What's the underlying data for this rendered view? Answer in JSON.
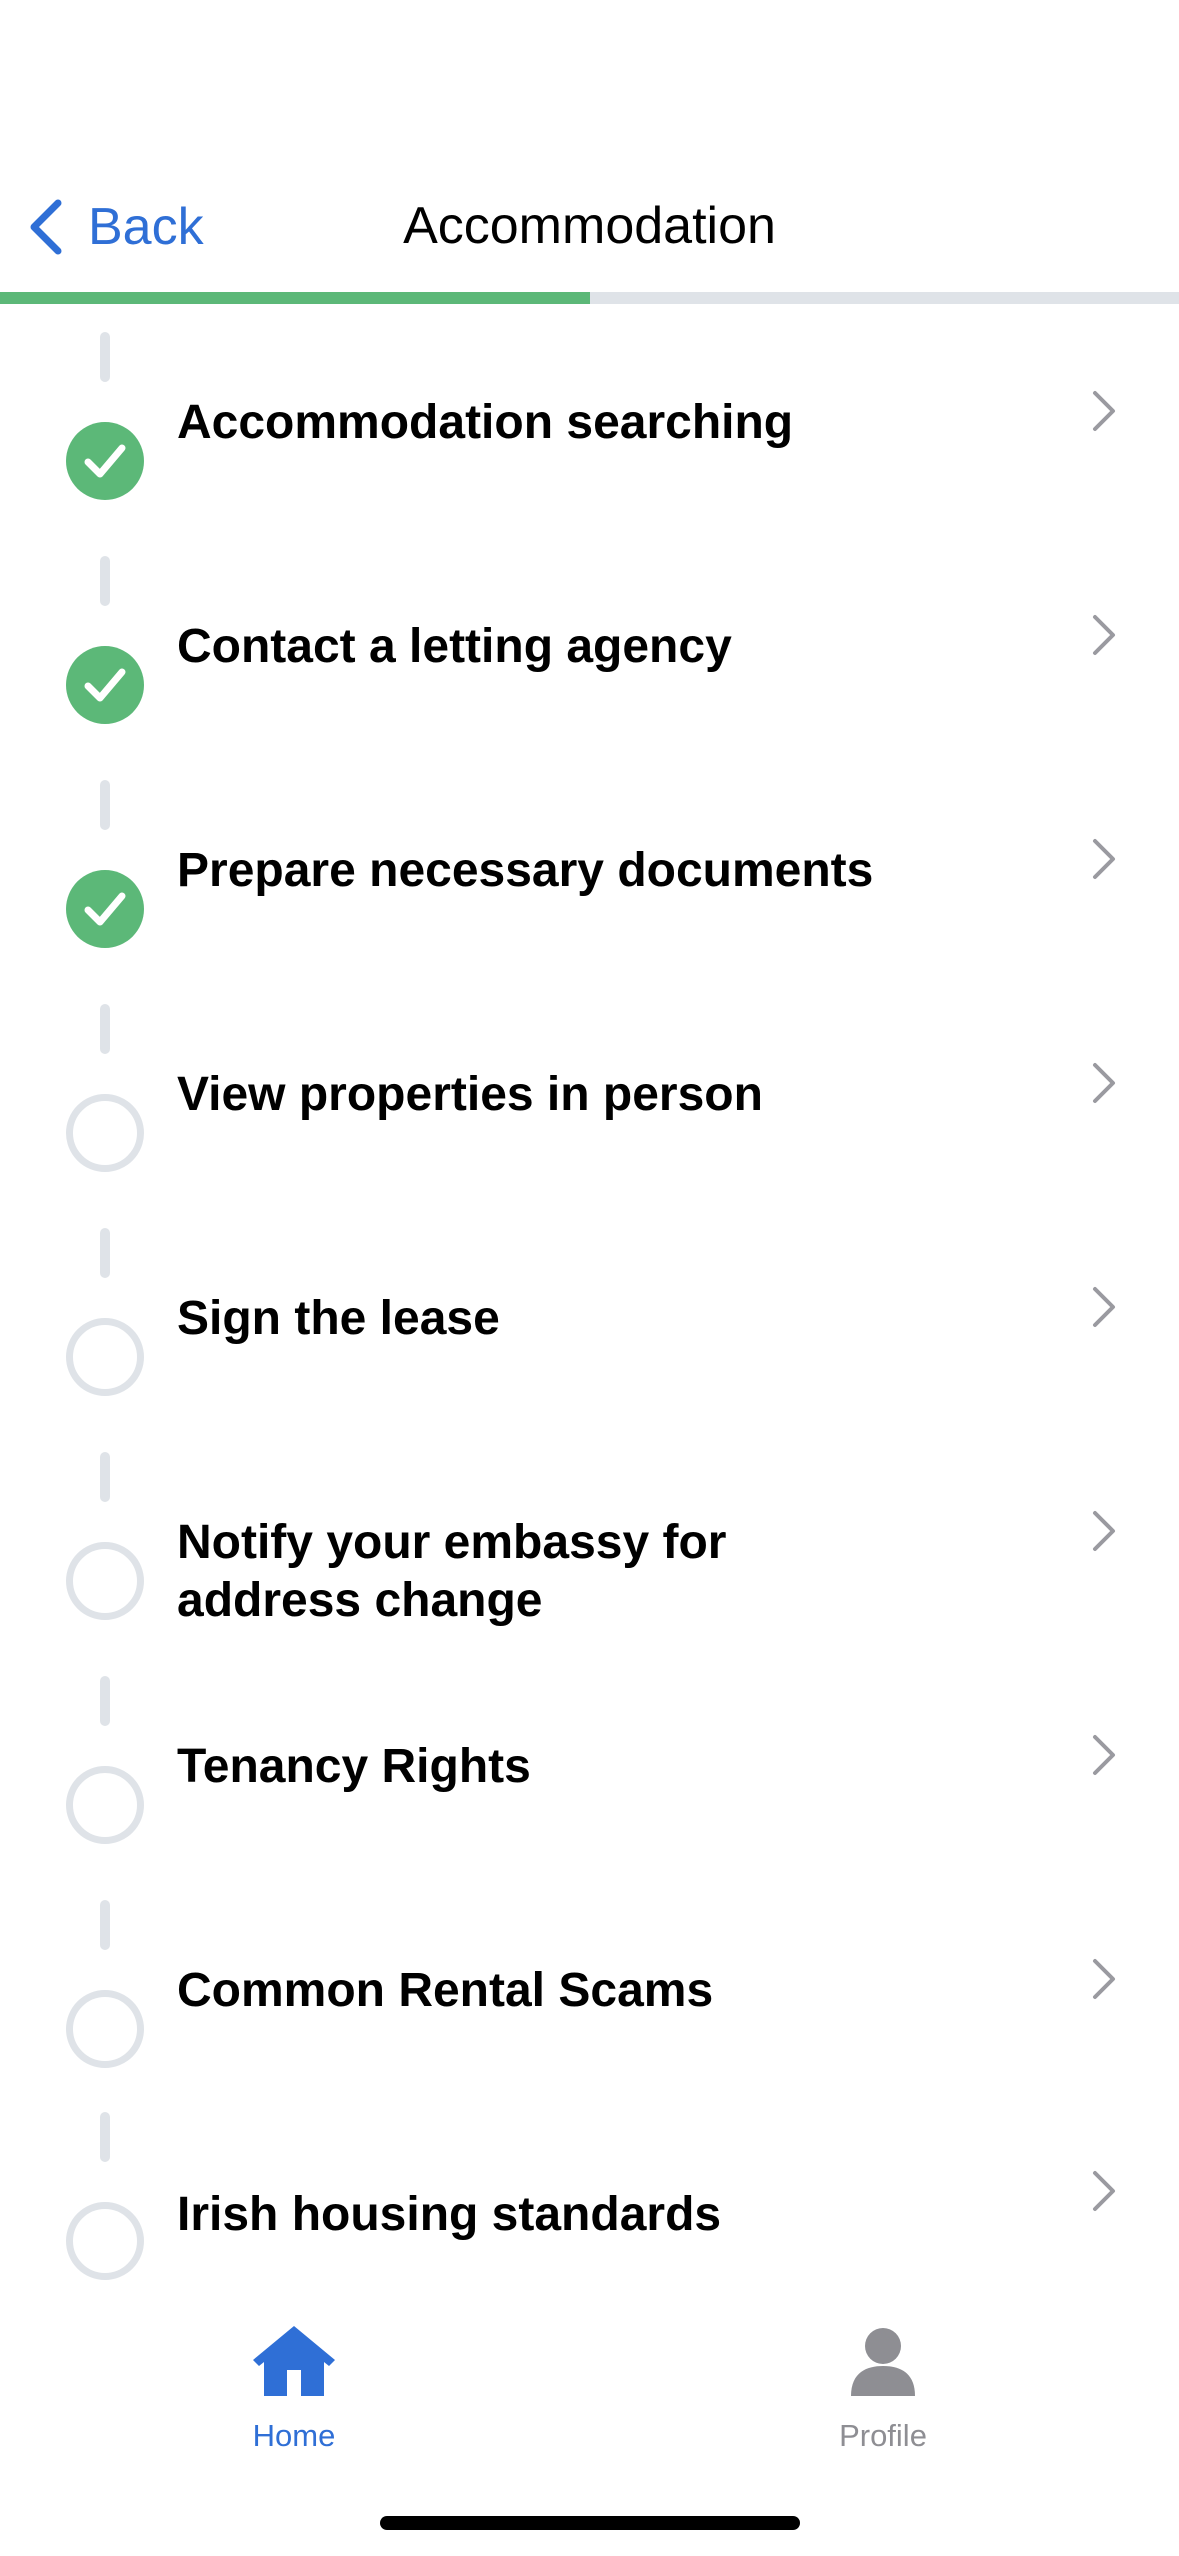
{
  "header": {
    "back_label": "Back",
    "title": "Accommodation",
    "progress": 0.5
  },
  "steps": [
    {
      "label": "Accommodation searching",
      "done": true
    },
    {
      "label": "Contact a letting agency",
      "done": true
    },
    {
      "label": "Prepare necessary documents",
      "done": true
    },
    {
      "label": "View properties in person",
      "done": false
    },
    {
      "label": "Sign the lease",
      "done": false
    },
    {
      "label": "Notify your embassy for address change",
      "done": false
    },
    {
      "label": "Tenancy Rights",
      "done": false
    },
    {
      "label": "Common Rental Scams",
      "done": false
    },
    {
      "label": "Irish housing standards",
      "done": false
    }
  ],
  "tabbar": {
    "home_label": "Home",
    "profile_label": "Profile"
  },
  "colors": {
    "accent": "#2f6fd6",
    "done": "#5cb878",
    "track": "#dfe3e8",
    "inactive": "#8e8e93"
  }
}
